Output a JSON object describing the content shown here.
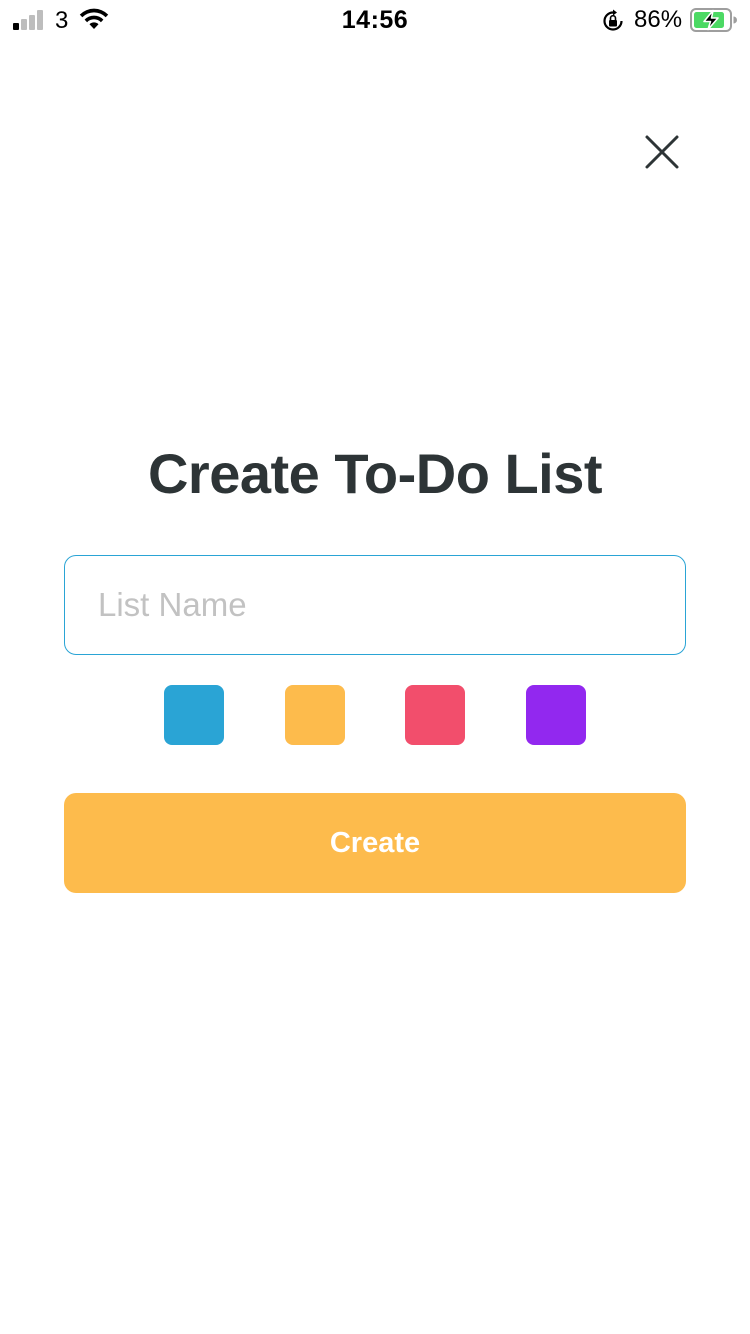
{
  "status_bar": {
    "carrier": "3",
    "time": "14:56",
    "battery_percent": "86%",
    "signal_bars_active": 1,
    "signal_bars_total": 4,
    "icons": [
      "signal-icon",
      "wifi-icon",
      "orientation-lock-icon",
      "battery-charging-icon"
    ]
  },
  "close": {
    "icon": "close-icon"
  },
  "form": {
    "title": "Create To-Do List",
    "list_name": {
      "value": "",
      "placeholder": "List Name"
    },
    "colors": [
      {
        "name": "blue",
        "hex": "#2aa4d5"
      },
      {
        "name": "orange",
        "hex": "#fdbb4c"
      },
      {
        "name": "red",
        "hex": "#f24e6c"
      },
      {
        "name": "purple",
        "hex": "#9228ef"
      }
    ],
    "selected_color": "#fdbb4c",
    "create_label": "Create"
  },
  "theme": {
    "title_color": "#2d3436",
    "input_border": "#2aa4d5",
    "placeholder_color": "#c2c2c2",
    "battery_fill": "#4cd964"
  }
}
